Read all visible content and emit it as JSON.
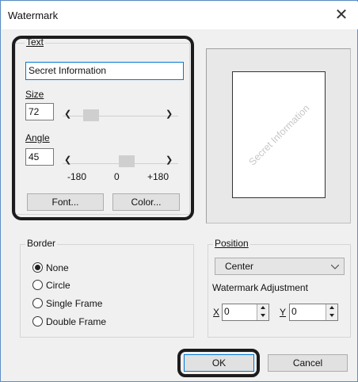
{
  "window": {
    "title": "Watermark",
    "close_glyph": "✕"
  },
  "text_group": {
    "label": "Text",
    "value": "Secret Information",
    "size_label": "Size",
    "size_value": "72",
    "angle_label": "Angle",
    "angle_value": "45",
    "angle_min": "-180",
    "angle_mid": "0",
    "angle_max": "+180",
    "font_button": "Font...",
    "color_button": "Color..."
  },
  "preview": {
    "watermark_text": "Secret Information"
  },
  "border_group": {
    "label": "Border",
    "options": [
      "None",
      "Circle",
      "Single Frame",
      "Double Frame"
    ],
    "selected": "None"
  },
  "position_group": {
    "label": "Position",
    "selected": "Center",
    "adjustment_label": "Watermark Adjustment",
    "x_label": "X",
    "x_value": "0",
    "y_label": "Y",
    "y_value": "0"
  },
  "footer": {
    "ok": "OK",
    "cancel": "Cancel"
  },
  "icons": {
    "left_arrow": "left-arrow-icon",
    "right_arrow": "right-arrow-icon",
    "dropdown": "chevron-down-icon"
  },
  "colors": {
    "accent": "#0078d7",
    "highlight_ring": "#1c1c1c",
    "preview_text": "#c8c8c8"
  }
}
